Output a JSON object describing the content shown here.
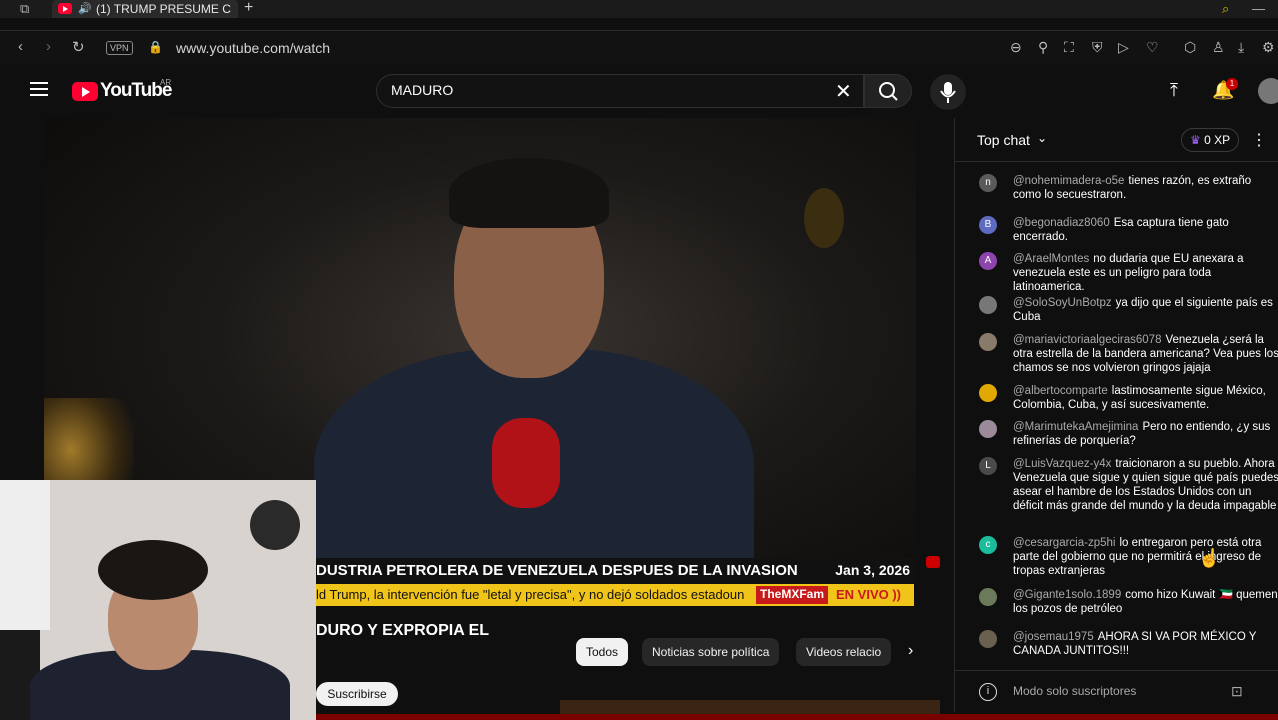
{
  "browser": {
    "tab_title": "(1) TRUMP PRESUME C",
    "new_tab": "+",
    "vpn_label": "VPN",
    "url": "www.youtube.com/watch"
  },
  "youtube": {
    "logo_text": "YouTube",
    "region": "AR",
    "search_value": "MADURO",
    "notification_count": "1"
  },
  "video": {
    "ticker_headline": "DUSTRIA PETROLERA DE VENEZUELA DESPUES DE LA INVASION",
    "ticker_date": "Jan 3, 2026",
    "ticker_subline": "ld Trump, la intervención fue \"letal y precisa\", y no dejó soldados estadoun",
    "brand_tag": "TheMXFam",
    "live_tag": "EN VIVO ))",
    "below_title": "DURO Y EXPROPIA EL"
  },
  "chips": [
    "Todos",
    "Noticias sobre política",
    "Videos relacio"
  ],
  "subscribe_label": "Suscribirse",
  "chat": {
    "title": "Top chat",
    "xp": "0 XP",
    "footer": "Modo solo suscriptores",
    "messages": [
      {
        "initial": "n",
        "color": "#5a5a5a",
        "author": "@nohemimadera-o5e",
        "text": "tienes razón, es extraño como lo secuestraron."
      },
      {
        "initial": "B",
        "color": "#5c6bc0",
        "author": "@begonadiaz8060",
        "text": "Esa captura tiene gato encerrado."
      },
      {
        "initial": "A",
        "color": "#8e44ad",
        "author": "@AraelMontes",
        "text": "no dudaria que EU anexara a venezuela este es un peligro para toda latinoamerica."
      },
      {
        "initial": "",
        "color": "#777777",
        "author": "@SoloSoyUnBotpz",
        "text": "ya dijo que el siguiente país es Cuba"
      },
      {
        "initial": "",
        "color": "#8a7a6a",
        "author": "@mariavictoriaalgeciras6078",
        "text": "Venezuela ¿será la otra estrella de la bandera americana? Vea pues los chamos se nos volvieron gringos jajaja"
      },
      {
        "initial": "",
        "color": "#e0a800",
        "author": "@albertocomparte",
        "text": "lastimosamente sigue México, Colombia, Cuba, y así sucesivamente."
      },
      {
        "initial": "",
        "color": "#9a8a9a",
        "author": "@MarimutekaAmejimina",
        "text": "Pero no entiendo, ¿y sus refinerías de porquería?"
      },
      {
        "initial": "L",
        "color": "#4a4a4a",
        "author": "@LuisVazquez-y4x",
        "text": "traicionaron a su pueblo. Ahora Venezuela que sigue y quien sigue qué país puedes asear el hambre de los Estados Unidos con un déficit más grande del mundo y la deuda impagable"
      },
      {
        "initial": "c",
        "color": "#1abc9c",
        "author": "@cesargarcia-zp5hi",
        "text": "lo entregaron pero está otra parte del gobierno que no permitirá el ingreso de tropas extranjeras"
      },
      {
        "initial": "",
        "color": "#6a7a5a",
        "author": "@Gigante1solo.1899",
        "text": "como hizo Kuwait 🇰🇼 quemen los pozos de petróleo"
      },
      {
        "initial": "",
        "color": "#6a6050",
        "author": "@josemau1975",
        "text": "AHORA SI VA POR MÉXICO Y CANADA JUNTITOS!!!"
      }
    ]
  },
  "icons": {
    "back": "back-arrow-icon",
    "forward": "forward-arrow-icon",
    "reload": "reload-icon",
    "lock": "lock-icon",
    "search": "search-icon",
    "mic": "mic-icon",
    "upload": "upload-icon",
    "bell": "bell-icon",
    "info": "info-icon"
  },
  "colors": {
    "youtube_red": "#ff0033",
    "ticker_yellow": "#f0c419",
    "background": "#0f0f0f"
  }
}
